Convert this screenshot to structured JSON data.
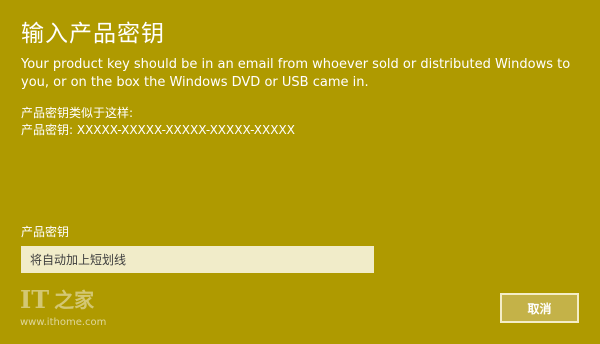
{
  "dialog": {
    "title": "输入产品密钥",
    "description": "Your product key should be in an email from whoever sold or distributed Windows to you, or on the box the Windows DVD or USB came in.",
    "example_heading": "产品密钥类似于这样:",
    "example_value": "产品密钥: XXXXX-XXXXX-XXXXX-XXXXX-XXXXX",
    "field_label": "产品密钥",
    "input_value": "",
    "input_placeholder": "将自动加上短划线",
    "cancel_label": "取消"
  },
  "watermark": {
    "logo_it": "IT",
    "logo_home": "之家",
    "url": "www.ithome.com"
  },
  "colors": {
    "background": "#af9a00",
    "input_background": "#f1ecc9",
    "button_background": "#c4b248",
    "button_border": "#f4edc7",
    "text": "#ffffff"
  }
}
